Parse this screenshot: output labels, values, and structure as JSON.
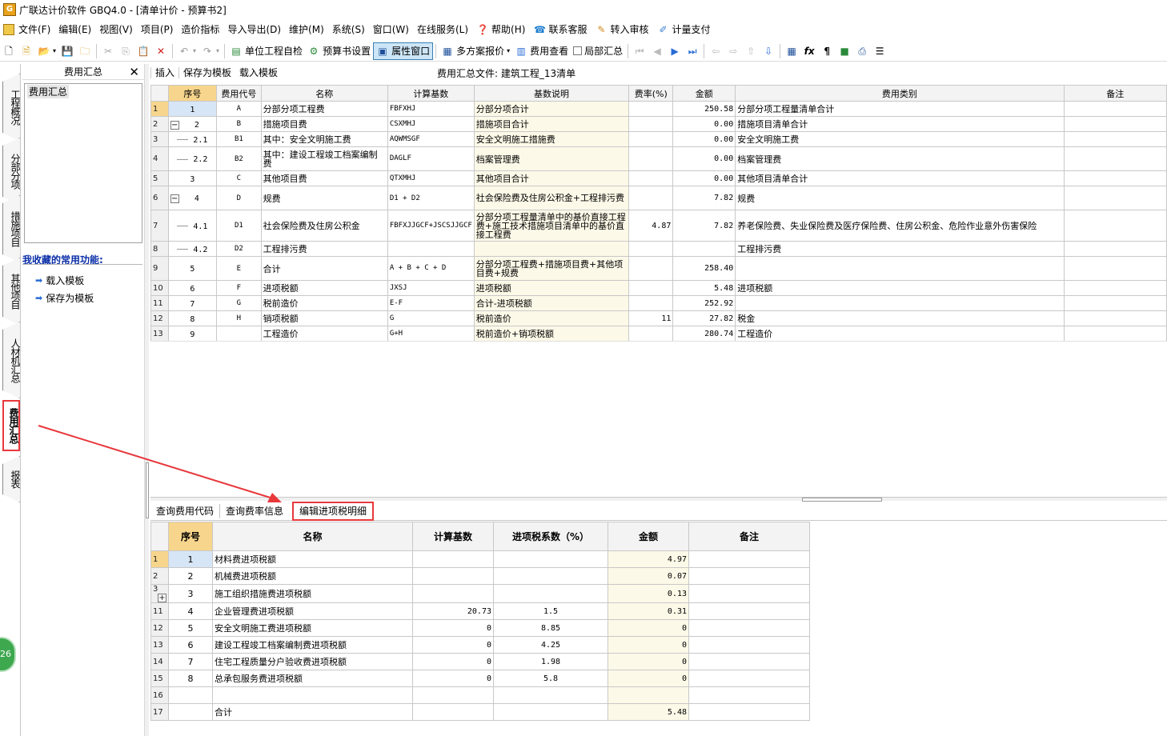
{
  "titlebar": {
    "title": "广联达计价软件 GBQ4.0 - [清单计价 - 预算书2]"
  },
  "menu": [
    "文件(F)",
    "编辑(E)",
    "视图(V)",
    "项目(P)",
    "造价指标",
    "导入导出(D)",
    "维护(M)",
    "系统(S)",
    "窗口(W)",
    "在线服务(L)",
    "帮助(H)",
    "联系客服",
    "转入审核",
    "计量支付"
  ],
  "toolbar": {
    "self_check": "单位工程自检",
    "budget_settings": "预算书设置",
    "property_window": "属性窗口",
    "multi_plan_quote": "多方案报价",
    "fee_view": "费用查看",
    "partial_summary": "局部汇总"
  },
  "vtabs": [
    "工程概况",
    "分部分项",
    "措施项目",
    "其他项目",
    "人材机汇总",
    "费用汇总",
    "报表"
  ],
  "sidepanel": {
    "title": "费用汇总",
    "tree_node": "费用汇总",
    "fav_title": "我收藏的常用功能:",
    "fav_items": [
      "载入模板",
      "保存为模板"
    ]
  },
  "upper": {
    "bar": [
      "插入",
      "保存为模板",
      "载入模板"
    ],
    "file_label": "费用汇总文件: 建筑工程_13清单",
    "headers": [
      "序号",
      "费用代号",
      "名称",
      "计算基数",
      "基数说明",
      "费率(%)",
      "金额",
      "费用类别",
      "备注"
    ],
    "rows": [
      {
        "rn": "1",
        "seq": "1",
        "code": "A",
        "name": "分部分项工程费",
        "base": "FBFXHJ",
        "desc": "分部分项合计",
        "rate": "",
        "amount": "250.58",
        "cat": "分部分项工程量清单合计",
        "note": ""
      },
      {
        "rn": "2",
        "seq": "2",
        "code": "B",
        "name": "措施项目费",
        "base": "CSXMHJ",
        "desc": "措施项目合计",
        "rate": "",
        "amount": "0.00",
        "cat": "措施项目清单合计",
        "note": ""
      },
      {
        "rn": "3",
        "seq": "2.1",
        "code": "B1",
        "name": "其中：安全文明施工费",
        "base": "AQWMSGF",
        "desc": "安全文明施工措施费",
        "rate": "",
        "amount": "0.00",
        "cat": "安全文明施工费",
        "note": ""
      },
      {
        "rn": "4",
        "seq": "2.2",
        "code": "B2",
        "name": "其中：建设工程竣工档案编制费",
        "base": "DAGLF",
        "desc": "档案管理费",
        "rate": "",
        "amount": "0.00",
        "cat": "档案管理费",
        "note": ""
      },
      {
        "rn": "5",
        "seq": "3",
        "code": "C",
        "name": "其他项目费",
        "base": "QTXMHJ",
        "desc": "其他项目合计",
        "rate": "",
        "amount": "0.00",
        "cat": "其他项目清单合计",
        "note": ""
      },
      {
        "rn": "6",
        "seq": "4",
        "code": "D",
        "name": "规费",
        "base": "D1 + D2",
        "desc": "社会保险费及住房公积金+工程排污费",
        "rate": "",
        "amount": "7.82",
        "cat": "规费",
        "note": ""
      },
      {
        "rn": "7",
        "seq": "4.1",
        "code": "D1",
        "name": "社会保险费及住房公积金",
        "base": "FBFXJJGCF+JSCSJJGCF",
        "desc": "分部分项工程量清单中的基价直接工程费+施工技术措施项目清单中的基价直接工程费",
        "rate": "4.87",
        "amount": "7.82",
        "cat": "养老保险费、失业保险费及医疗保险费、住房公积金、危险作业意外伤害保险",
        "note": ""
      },
      {
        "rn": "8",
        "seq": "4.2",
        "code": "D2",
        "name": "工程排污费",
        "base": "",
        "desc": "",
        "rate": "",
        "amount": "",
        "cat": "工程排污费",
        "note": ""
      },
      {
        "rn": "9",
        "seq": "5",
        "code": "E",
        "name": "合计",
        "base": "A + B + C + D",
        "desc": "分部分项工程费+措施项目费+其他项目费+规费",
        "rate": "",
        "amount": "258.40",
        "cat": "",
        "note": ""
      },
      {
        "rn": "10",
        "seq": "6",
        "code": "F",
        "name": "进项税额",
        "base": "JXSJ",
        "desc": "进项税额",
        "rate": "",
        "amount": "5.48",
        "cat": "进项税额",
        "note": ""
      },
      {
        "rn": "11",
        "seq": "7",
        "code": "G",
        "name": "税前造价",
        "base": "E-F",
        "desc": "合计-进项税额",
        "rate": "",
        "amount": "252.92",
        "cat": "",
        "note": ""
      },
      {
        "rn": "12",
        "seq": "8",
        "code": "H",
        "name": "销项税额",
        "base": "G",
        "desc": "税前造价",
        "rate": "11",
        "amount": "27.82",
        "cat": "税金",
        "note": ""
      },
      {
        "rn": "13",
        "seq": "9",
        "code": "",
        "name": "工程造价",
        "base": "G+H",
        "desc": "税前造价+销项税额",
        "rate": "",
        "amount": "280.74",
        "cat": "工程造价",
        "note": ""
      }
    ]
  },
  "lower": {
    "tabs": [
      "查询费用代码",
      "查询费率信息",
      "编辑进项税明细"
    ],
    "headers": [
      "序号",
      "名称",
      "计算基数",
      "进项税系数（%）",
      "金额",
      "备注"
    ],
    "rows": [
      {
        "rn": "1",
        "seq": "1",
        "name": "材料费进项税额",
        "base": "",
        "coef": "",
        "amount": "4.97",
        "note": ""
      },
      {
        "rn": "2",
        "seq": "2",
        "name": "机械费进项税额",
        "base": "",
        "coef": "",
        "amount": "0.07",
        "note": ""
      },
      {
        "rn": "3",
        "seq": "3",
        "name": "施工组织措施费进项税额",
        "base": "",
        "coef": "",
        "amount": "0.13",
        "note": ""
      },
      {
        "rn": "11",
        "seq": "4",
        "name": "企业管理费进项税额",
        "base": "20.73",
        "coef": "1.5",
        "amount": "0.31",
        "note": ""
      },
      {
        "rn": "12",
        "seq": "5",
        "name": "安全文明施工费进项税额",
        "base": "0",
        "coef": "8.85",
        "amount": "0",
        "note": ""
      },
      {
        "rn": "13",
        "seq": "6",
        "name": "建设工程竣工档案编制费进项税额",
        "base": "0",
        "coef": "4.25",
        "amount": "0",
        "note": ""
      },
      {
        "rn": "14",
        "seq": "7",
        "name": "住宅工程质量分户验收费进项税额",
        "base": "0",
        "coef": "1.98",
        "amount": "0",
        "note": ""
      },
      {
        "rn": "15",
        "seq": "8",
        "name": "总承包服务费进项税额",
        "base": "0",
        "coef": "5.8",
        "amount": "0",
        "note": ""
      },
      {
        "rn": "16",
        "seq": "",
        "name": "",
        "base": "",
        "coef": "",
        "amount": "",
        "note": ""
      },
      {
        "rn": "17",
        "seq": "",
        "name": "合计",
        "base": "",
        "coef": "",
        "amount": "5.48",
        "note": ""
      }
    ]
  },
  "badge": "26",
  "colors": {
    "accent": "#e8383c",
    "header_highlight": "#f7d58c",
    "link_blue": "#0b2ea8"
  }
}
